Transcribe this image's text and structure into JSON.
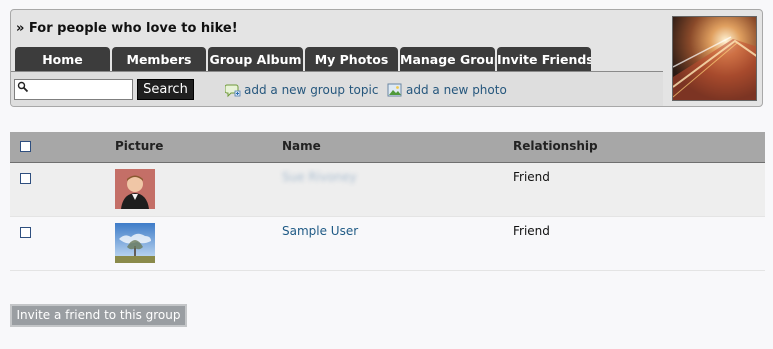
{
  "group": {
    "title": "» For people who love to hike!"
  },
  "tabs": [
    {
      "label": "Home"
    },
    {
      "label": "Members"
    },
    {
      "label": "Group Album"
    },
    {
      "label": "My Photos"
    },
    {
      "label": "Manage Group"
    },
    {
      "label": "Invite Friends"
    }
  ],
  "toolbar": {
    "search_value": "",
    "search_button": "Search",
    "add_topic": "add a new group topic",
    "add_photo": "add a new photo"
  },
  "members_table": {
    "columns": {
      "picture": "Picture",
      "name": "Name",
      "relationship": "Relationship"
    },
    "rows": [
      {
        "name": "Sue Rivoney",
        "relationship": "Friend"
      },
      {
        "name": "Sample User",
        "relationship": "Friend"
      }
    ]
  },
  "invite_button": "Invite a friend to this group",
  "icons": {
    "search": "magnifier-icon",
    "topic": "add-topic-icon",
    "photo": "add-photo-icon"
  },
  "colors": {
    "tab_bg": "#3c3c3c",
    "link": "#26577d",
    "table_header_bg": "#a7a7a7",
    "button_bg": "#9a9ea2"
  }
}
